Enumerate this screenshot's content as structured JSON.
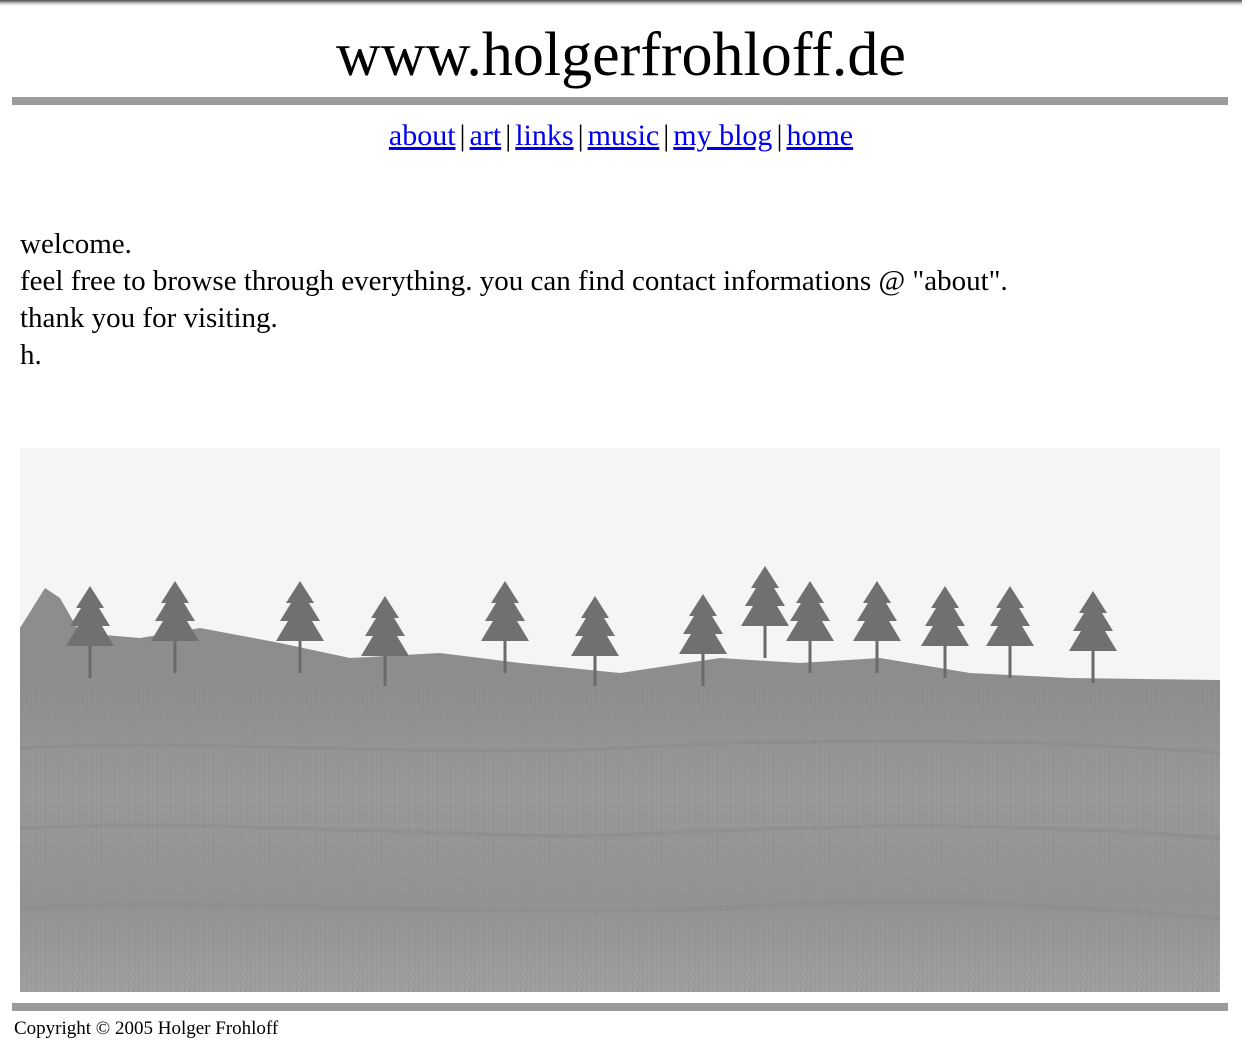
{
  "header": {
    "site_title": "www.holgerfrohloff.de"
  },
  "nav": {
    "separator": "|",
    "items": [
      {
        "label": "about"
      },
      {
        "label": "art"
      },
      {
        "label": "links"
      },
      {
        "label": "music"
      },
      {
        "label": "my blog"
      },
      {
        "label": "home"
      }
    ],
    "link_color": "#0000ee"
  },
  "main": {
    "lines": [
      "welcome.",
      "feel free to browse through everything. you can find contact informations @ \"about\".",
      "thank you for visiting.",
      "h."
    ],
    "photo_description": "grayscale field with a row of trees"
  },
  "footer": {
    "copyright": "Copyright © 2005 Holger Frohloff"
  },
  "colors": {
    "rule": "#9b9b9b",
    "background": "#ffffff"
  }
}
